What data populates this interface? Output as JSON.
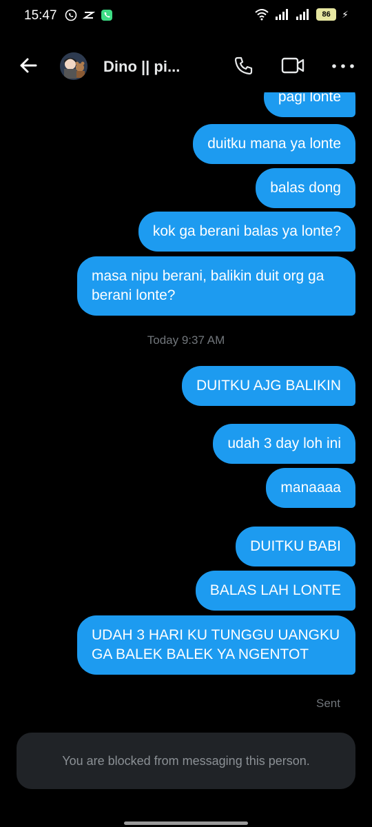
{
  "status_bar": {
    "time": "15:47",
    "battery": "86",
    "icons": [
      "whatsapp-icon",
      "capcut-icon",
      "phone-app-icon",
      "wifi-icon",
      "signal-icon",
      "signal-icon",
      "battery-icon",
      "charging-icon"
    ]
  },
  "header": {
    "title": "Dino || pi...",
    "icons": [
      "back-arrow-icon",
      "phone-icon",
      "video-icon",
      "more-icon"
    ]
  },
  "messages": [
    {
      "text": "pagi lonte"
    },
    {
      "text": "duitku mana ya lonte"
    },
    {
      "text": "balas dong"
    },
    {
      "text": "kok ga berani balas ya lonte?"
    },
    {
      "text": "masa nipu berani, balikin duit org ga berani lonte?"
    },
    {
      "text": "DUITKU AJG BALIKIN"
    },
    {
      "text": "udah 3 day loh ini"
    },
    {
      "text": "manaaaa"
    },
    {
      "text": "DUITKU BABI"
    },
    {
      "text": "BALAS LAH LONTE"
    },
    {
      "text": "UDAH 3 HARI KU TUNGGU UANGKU GA BALEK BALEK YA NGENTOT"
    }
  ],
  "timestamp": "Today 9:37 AM",
  "sent_label": "Sent",
  "composer": {
    "blocked_text": "You are blocked from messaging this person."
  },
  "colors": {
    "background": "#000000",
    "bubble": "#1d9bf0",
    "muted_text": "#71767b",
    "composer_bg": "#202327"
  }
}
